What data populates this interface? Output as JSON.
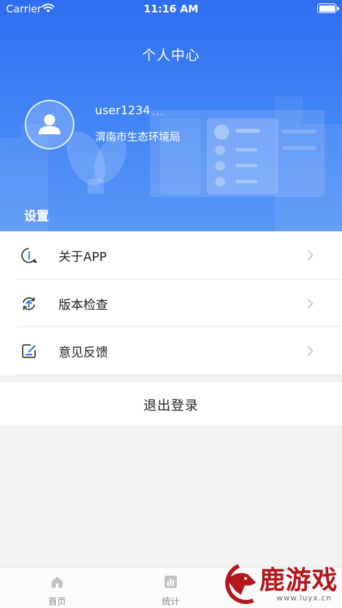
{
  "status_bar": {
    "carrier": "Carrier",
    "time": "11:16 AM"
  },
  "header": {
    "title": "个人中心"
  },
  "profile": {
    "username": "user1234",
    "organization": "渭南市生态环境局"
  },
  "settings": {
    "section_label": "设置",
    "items": [
      {
        "label": "关于APP",
        "icon": "info-icon"
      },
      {
        "label": "版本检查",
        "icon": "update-icon"
      },
      {
        "label": "意见反馈",
        "icon": "feedback-icon"
      }
    ]
  },
  "logout": {
    "label": "退出登录"
  },
  "tabbar": {
    "tabs": [
      {
        "label": "首页",
        "icon": "home-icon"
      },
      {
        "label": "统计",
        "icon": "stats-icon"
      }
    ]
  },
  "watermark": {
    "text": "鹿游戏",
    "url": "www.luyx.cn"
  },
  "colors": {
    "primary": "#3f82f5",
    "text": "#222222",
    "muted": "#8a8a8a"
  }
}
